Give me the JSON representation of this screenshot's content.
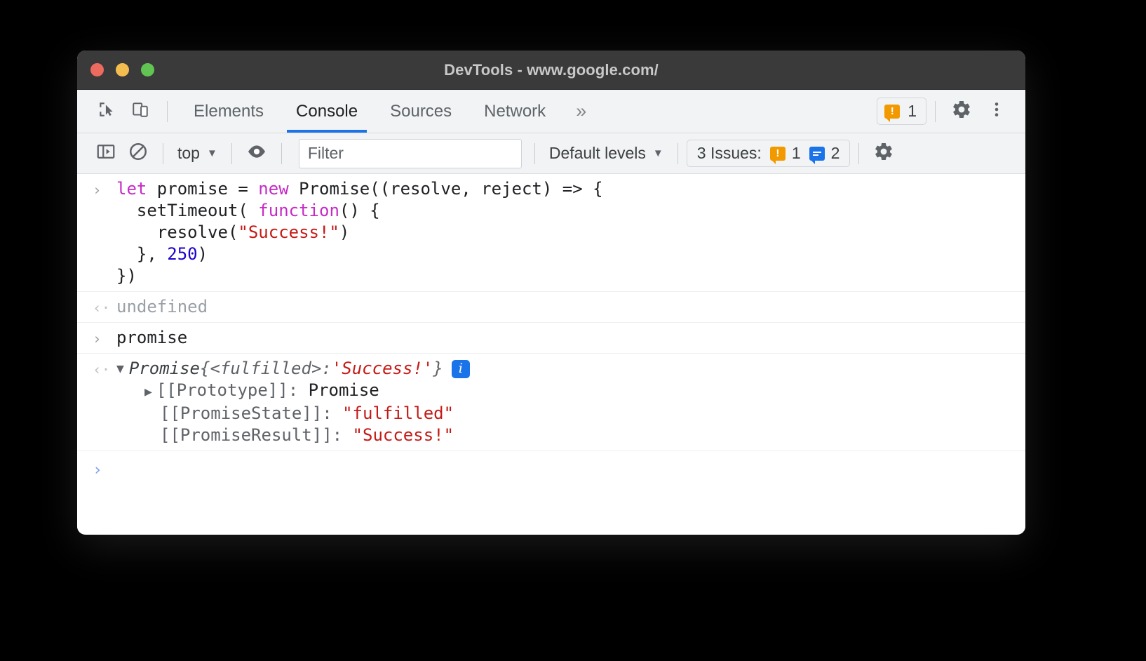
{
  "window": {
    "title": "DevTools - www.google.com/",
    "traffic_lights": [
      "close-red",
      "minimize-amber",
      "maximize-green"
    ]
  },
  "tabbar": {
    "inspect_icon": "inspect-element-icon",
    "device_icon": "device-toolbar-icon",
    "tabs": [
      {
        "label": "Elements",
        "active": false
      },
      {
        "label": "Console",
        "active": true
      },
      {
        "label": "Sources",
        "active": false
      },
      {
        "label": "Network",
        "active": false
      }
    ],
    "more_tabs_label": "»",
    "warning_badge": {
      "icon": "warning-bubble-icon",
      "count": "1"
    },
    "settings_icon": "gear-icon",
    "menu_icon": "more-vertical-icon"
  },
  "console_toolbar": {
    "sidebar_toggle_icon": "console-sidebar-icon",
    "clear_console_icon": "clear-console-icon",
    "context_selector": {
      "value": "top",
      "caret": "▼"
    },
    "live_expression_icon": "eye-icon",
    "filter": {
      "placeholder": "Filter",
      "value": ""
    },
    "levels_selector": {
      "value": "Default levels",
      "caret": "▼"
    },
    "issues": {
      "label": "3 Issues:",
      "warning_count": "1",
      "info_count": "2",
      "warning_icon": "warning-bubble-icon",
      "info_icon": "info-bubble-icon"
    },
    "settings_icon": "gear-icon"
  },
  "console": {
    "entries": [
      {
        "kind": "input",
        "gutter": "›",
        "lines": [
          [
            {
              "t": "let ",
              "c": "kw"
            },
            {
              "t": "promise = ",
              "c": "plain"
            },
            {
              "t": "new ",
              "c": "kw"
            },
            {
              "t": "Promise((resolve, reject) => {",
              "c": "plain"
            }
          ],
          [
            {
              "t": "  setTimeout( ",
              "c": "plain"
            },
            {
              "t": "function",
              "c": "kw"
            },
            {
              "t": "() {",
              "c": "plain"
            }
          ],
          [
            {
              "t": "    resolve(",
              "c": "plain"
            },
            {
              "t": "\"Success!\"",
              "c": "str"
            },
            {
              "t": ")",
              "c": "plain"
            }
          ],
          [
            {
              "t": "  }, ",
              "c": "plain"
            },
            {
              "t": "250",
              "c": "num"
            },
            {
              "t": ")",
              "c": "plain"
            }
          ],
          [
            {
              "t": "})",
              "c": "plain"
            }
          ]
        ]
      },
      {
        "kind": "output",
        "gutter": "‹·",
        "text": "undefined"
      },
      {
        "kind": "input",
        "gutter": "›",
        "lines": [
          [
            {
              "t": "promise",
              "c": "plain"
            }
          ]
        ]
      },
      {
        "kind": "object",
        "gutter": "‹·",
        "disclosure": "▼",
        "class_name": "Promise",
        "preview_open": " {",
        "preview_state": "<fulfilled>",
        "preview_colon": ": ",
        "preview_value": "'Success!'",
        "preview_close": "}",
        "info_badge": "i",
        "properties": [
          {
            "disclosure": "▶",
            "key": "[[Prototype]]",
            "sep": ": ",
            "value": "Promise",
            "value_kind": "plain"
          },
          {
            "disclosure": "",
            "key": "[[PromiseState]]",
            "sep": ": ",
            "value": "\"fulfilled\"",
            "value_kind": "string"
          },
          {
            "disclosure": "",
            "key": "[[PromiseResult]]",
            "sep": ": ",
            "value": "\"Success!\"",
            "value_kind": "string"
          }
        ]
      }
    ],
    "prompt": {
      "caret": "›",
      "value": ""
    }
  },
  "colors": {
    "accent_blue": "#1a73e8",
    "warning_orange": "#f29900",
    "string_red": "#c41a16",
    "keyword_magenta": "#c62ac6",
    "number_blue": "#1c00cf",
    "toolbar_bg": "#f1f3f4",
    "titlebar_bg": "#3a3a3a"
  }
}
